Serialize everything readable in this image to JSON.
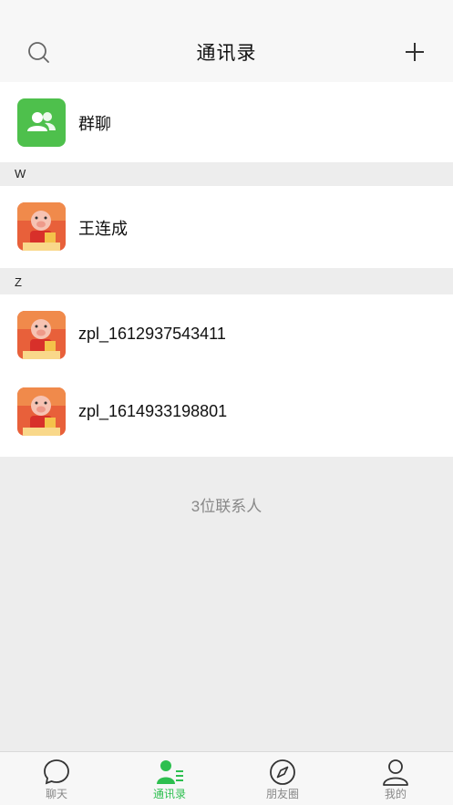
{
  "header": {
    "title": "通讯录"
  },
  "group_chat": {
    "label": "群聊",
    "color": "#4ec04c"
  },
  "sections": [
    {
      "letter": "W",
      "contacts": [
        {
          "name": "王连成"
        }
      ]
    },
    {
      "letter": "Z",
      "contacts": [
        {
          "name": "zpl_1612937543411"
        },
        {
          "name": "zpl_1614933198801"
        }
      ]
    }
  ],
  "footer": {
    "count_text": "3位联系人"
  },
  "tabbar": {
    "tabs": [
      {
        "label": "聊天",
        "icon": "chat-bubble-icon",
        "active": false
      },
      {
        "label": "通讯录",
        "icon": "contacts-icon",
        "active": true
      },
      {
        "label": "朋友圈",
        "icon": "compass-icon",
        "active": false
      },
      {
        "label": "我的",
        "icon": "person-icon",
        "active": false
      }
    ],
    "active_color": "#2dbf4f"
  }
}
